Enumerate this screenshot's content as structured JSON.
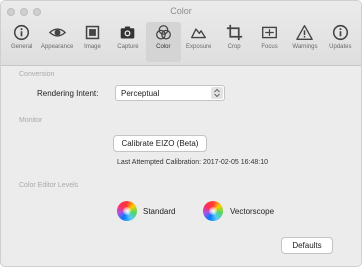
{
  "window": {
    "title": "Color"
  },
  "toolbar": {
    "tabs": [
      {
        "label": "General",
        "icon": "info-circle-icon"
      },
      {
        "label": "Appearance",
        "icon": "eye-icon"
      },
      {
        "label": "Image",
        "icon": "image-icon"
      },
      {
        "label": "Capture",
        "icon": "camera-icon"
      },
      {
        "label": "Color",
        "icon": "color-circles-icon",
        "active": true
      },
      {
        "label": "Exposure",
        "icon": "exposure-icon"
      },
      {
        "label": "Crop",
        "icon": "crop-icon"
      },
      {
        "label": "Focus",
        "icon": "focus-icon"
      },
      {
        "label": "Warnings",
        "icon": "warning-icon"
      },
      {
        "label": "Updates",
        "icon": "info-circle-icon"
      }
    ]
  },
  "conversion": {
    "section_title": "Conversion",
    "rendering_intent_label": "Rendering Intent:",
    "rendering_intent_value": "Perceptual"
  },
  "monitor": {
    "section_title": "Monitor",
    "calibrate_button": "Calibrate EIZO (Beta)",
    "last_calibration": "Last Attempted Calibration: 2017-02-05 16:48:10"
  },
  "color_editor": {
    "section_title": "Color Editor Levels",
    "options": [
      {
        "label": "Standard"
      },
      {
        "label": "Vectorscope"
      }
    ]
  },
  "footer": {
    "defaults_button": "Defaults"
  },
  "colors": {
    "window_bg": "#ececec",
    "active_tab_bg": "#d4d4d4",
    "section_title": "#a9a9a9"
  }
}
